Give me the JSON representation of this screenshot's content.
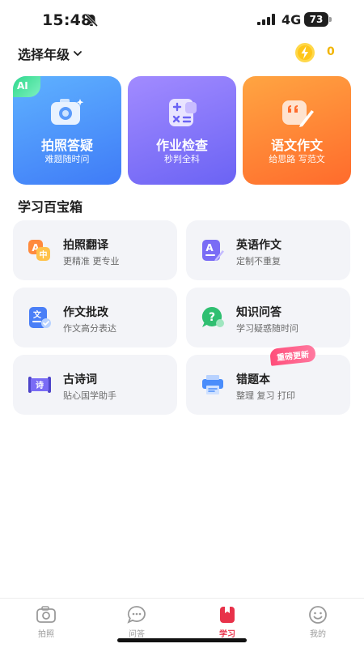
{
  "status_bar": {
    "time": "15:48",
    "network": "4G",
    "battery": "73"
  },
  "header": {
    "grade_label": "选择年级",
    "energy_count": "0"
  },
  "features": [
    {
      "title": "拍照答疑",
      "subtitle": "难题随时问",
      "badge": "AI",
      "icon": "camera-icon",
      "color": "#4a8dfb"
    },
    {
      "title": "作业检查",
      "subtitle": "秒判全科",
      "icon": "calculator-icon",
      "color": "#7d6ff7"
    },
    {
      "title": "语文作文",
      "subtitle": "给思路 写范文",
      "icon": "quote-pen-icon",
      "color": "#ff7f33"
    }
  ],
  "section": {
    "title": "学习百宝箱"
  },
  "tools": [
    {
      "title": "拍照翻译",
      "subtitle": "更精准 更专业",
      "icon": "translate-icon"
    },
    {
      "title": "英语作文",
      "subtitle": "定制不重复",
      "icon": "english-writing-icon"
    },
    {
      "title": "作文批改",
      "subtitle": "作文高分表达",
      "icon": "essay-correct-icon"
    },
    {
      "title": "知识问答",
      "subtitle": "学习疑惑随时问",
      "icon": "question-bubble-icon"
    },
    {
      "title": "古诗词",
      "subtitle": "贴心国学助手",
      "icon": "poem-scroll-icon"
    },
    {
      "title": "错题本",
      "subtitle": "整理 复习 打印",
      "icon": "printer-icon",
      "badge": "重磅更新"
    }
  ],
  "tabs": [
    {
      "label": "拍照",
      "icon": "camera-tab-icon",
      "active": false
    },
    {
      "label": "问答",
      "icon": "chat-tab-icon",
      "active": false
    },
    {
      "label": "学习",
      "icon": "book-tab-icon",
      "active": true
    },
    {
      "label": "我的",
      "icon": "smile-tab-icon",
      "active": false
    }
  ],
  "colors": {
    "accent": "#e8324a",
    "energy": "#f1b400",
    "card_bg": "#f3f4f8"
  }
}
